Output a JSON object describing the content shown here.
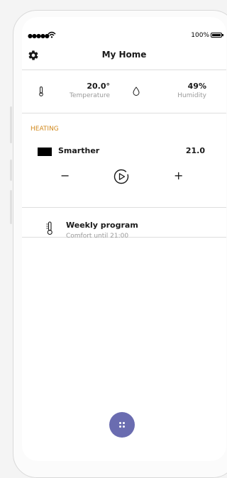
{
  "status_bar": {
    "signal": "●●●●●",
    "battery_percent": "100%"
  },
  "header": {
    "title": "My Home",
    "settings_icon": "gear-icon"
  },
  "climate": {
    "temperature": {
      "value": "20.0°",
      "label": "Temperature",
      "icon": "thermometer-icon"
    },
    "humidity": {
      "value": "49%",
      "label": "Humidity",
      "icon": "water-drop-icon"
    }
  },
  "heating": {
    "section_label": "HEATING",
    "device": {
      "name": "Smarther",
      "setpoint": "21.0",
      "decrease_label": "−",
      "increase_label": "+",
      "play_icon": "play-circle-icon"
    },
    "program": {
      "title": "Weekly program",
      "subtitle": "Comfort until 21:00",
      "icon": "thermometer-icon"
    }
  },
  "fab": {
    "icon": "dots-grid-icon"
  },
  "colors": {
    "accent": "#6a6cb0",
    "section_label": "#d28a1e",
    "divider": "#dedede",
    "muted_text": "#9a9a9a"
  }
}
